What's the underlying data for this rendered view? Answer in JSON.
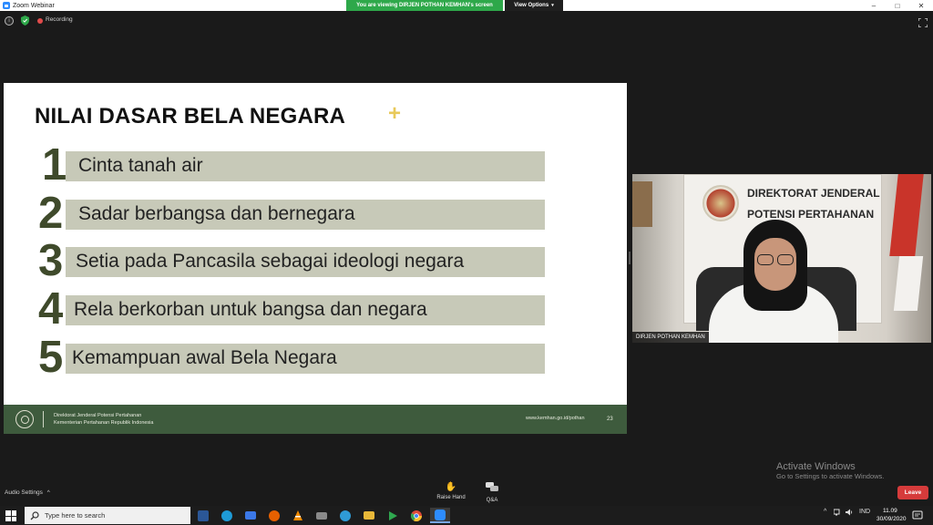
{
  "window": {
    "title": "Zoom Webinar",
    "controls": [
      "–",
      "□",
      "✕"
    ]
  },
  "share_banner": {
    "text": "You are viewing DIRJEN POTHAN KEMHAN's screen",
    "view_options": "View Options",
    "caret": "▾"
  },
  "status": {
    "info": "i",
    "recording_label": "Recording"
  },
  "slide": {
    "title": "NILAI DASAR BELA NEGARA",
    "plus": "+",
    "items": [
      {
        "num": "1",
        "text": "Cinta tanah air"
      },
      {
        "num": "2",
        "text": "Sadar berbangsa dan bernegara"
      },
      {
        "num": "3",
        "text": "Setia pada Pancasila sebagai ideologi negara"
      },
      {
        "num": "4",
        "text": "Rela berkorban untuk bangsa dan negara"
      },
      {
        "num": "5",
        "text": "Kemampuan awal Bela Negara"
      }
    ],
    "footer": {
      "org_line1": "Direktorat Jenderal Potensi Pertahanan",
      "org_line2": "Kementerian Pertahanan Republik Indonesia",
      "url": "www.kemhan.go.id/pothan",
      "page": "23"
    }
  },
  "video": {
    "plaque_line1": "DIREKTORAT JENDERAL",
    "plaque_line2": "POTENSI PERTAHANAN",
    "name": "DIRJEN POTHAN KEMHAN"
  },
  "watermark": {
    "line1": "Activate Windows",
    "line2": "Go to Settings to activate Windows."
  },
  "meeting_controls": {
    "audio_settings": "Audio Settings",
    "audio_caret": "^",
    "raise_hand": "Raise Hand",
    "qa": "Q&A",
    "leave": "Leave"
  },
  "taskbar": {
    "search_placeholder": "Type here to search",
    "apps": [
      {
        "name": "word",
        "color": "#2b5797"
      },
      {
        "name": "edge",
        "color": "#1e9bd7"
      },
      {
        "name": "mail",
        "color": "#3b78e7"
      },
      {
        "name": "firefox",
        "color": "#e66000"
      },
      {
        "name": "vlc",
        "color": "#f08a00"
      },
      {
        "name": "scanner",
        "color": "#8a8a8a"
      },
      {
        "name": "edge-legacy",
        "color": "#2f9bd6"
      },
      {
        "name": "file-explorer",
        "color": "#e8b839"
      },
      {
        "name": "media-app",
        "color": "#2fa84f"
      },
      {
        "name": "chrome",
        "color": "#dd4b39"
      },
      {
        "name": "zoom",
        "color": "#2d8cff"
      }
    ],
    "tray": {
      "chevron": "^",
      "lang": "IND",
      "time": "11.09",
      "date": "30/09/2020"
    }
  },
  "colors": {
    "slide_bar": "#c7c9b8",
    "slide_number": "#3f4a2b",
    "slide_footer": "#3e5b3d",
    "share_banner": "#2ea84a",
    "leave": "#d63b3b",
    "plus_accent": "#e8c95a"
  }
}
